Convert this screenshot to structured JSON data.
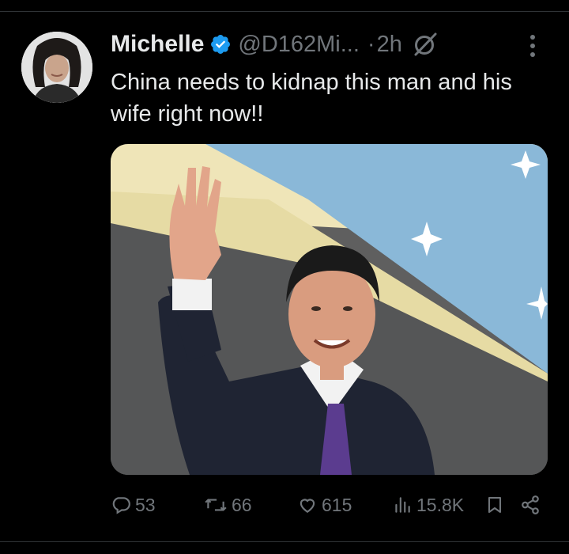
{
  "author": {
    "name": "Michelle",
    "handle": "@D162Mi...",
    "separator": "·",
    "time": "2h",
    "verified": true,
    "avatar_icon": "user-avatar"
  },
  "tweet": {
    "text": "China needs to kidnap this man and his wife right now!!"
  },
  "media": {
    "kind": "photo"
  },
  "actions": {
    "replies": "53",
    "reposts": "66",
    "likes": "615",
    "views": "15.8K"
  },
  "colors": {
    "background": "#000000",
    "text": "#e7e9ea",
    "muted": "#71767b",
    "verified": "#1d9bf0",
    "divider": "#2f3336"
  },
  "icons": [
    "verified-badge-icon",
    "grok-icon",
    "more-icon",
    "reply-icon",
    "repost-icon",
    "like-icon",
    "views-icon",
    "bookmark-icon",
    "share-icon"
  ]
}
